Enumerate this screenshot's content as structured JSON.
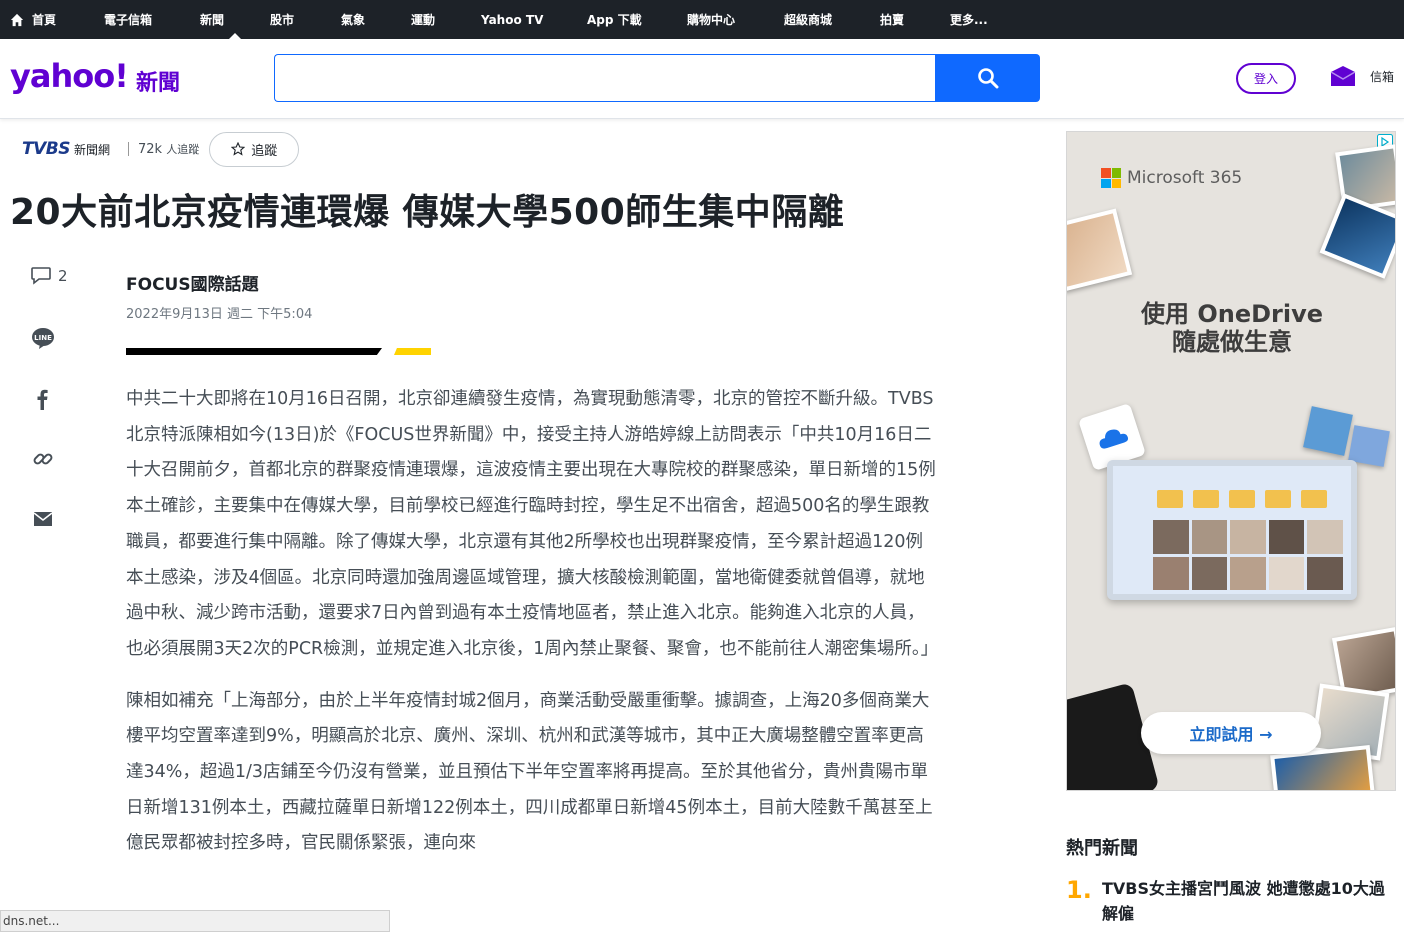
{
  "topnav": {
    "items": [
      "首頁",
      "電子信箱",
      "新聞",
      "股市",
      "氣象",
      "運動",
      "Yahoo TV",
      "App 下載",
      "購物中心",
      "超級商城",
      "拍賣",
      "更多..."
    ],
    "active_index": 2
  },
  "header": {
    "logo": "yahoo!",
    "logo_sub": "新聞",
    "search_value": "",
    "login_label": "登入",
    "mail_label": "信箱"
  },
  "source": {
    "publisher_logo": "TVBS",
    "publisher_sub": "新聞網",
    "followers_count": "72k",
    "followers_label": "人追蹤",
    "follow_label": "追蹤"
  },
  "article": {
    "headline": "20大前北京疫情連環爆 傳媒大學500師生集中隔離",
    "comment_count": "2",
    "author": "FOCUS國際話題",
    "date": "2022年9月13日 週二 下午5:04",
    "paragraphs": [
      "中共二十大即將在10月16日召開，北京卻連續發生疫情，為實現動態清零，北京的管控不斷升級。TVBS北京特派陳相如今(13日)於《FOCUS世界新聞》中，接受主持人游皓婷線上訪問表示「中共10月16日二十大召開前夕，首都北京的群聚疫情連環爆，這波疫情主要出現在大專院校的群聚感染，單日新增的15例本土確診，主要集中在傳媒大學，目前學校已經進行臨時封控，學生足不出宿舍，超過500名的學生跟教職員，都要進行集中隔離。除了傳媒大學，北京還有其他2所學校也出現群聚疫情，至今累計超過120例本土感染，涉及4個區。北京同時還加強周邊區域管理，擴大核酸檢測範圍，當地衛健委就曾倡導，就地過中秋、減少跨市活動，還要求7日內曾到過有本土疫情地區者，禁止進入北京。能夠進入北京的人員，也必須展開3天2次的PCR檢測，並規定進入北京後，1周內禁止聚餐、聚會，也不能前往人潮密集場所。」",
      "陳相如補充「上海部分，由於上半年疫情封城2個月，商業活動受嚴重衝擊。據調查，上海20多個商業大樓平均空置率達到9%，明顯高於北京、廣州、深圳、杭州和武漢等城市，其中正大廣場整體空置率更高達34%，超過1/3店鋪至今仍沒有營業，並且預估下半年空置率將再提高。至於其他省分，貴州貴陽市單日新增131例本土，西藏拉薩單日新增122例本土，四川成都單日新增45例本土，目前大陸數千萬甚至上億民眾都被封控多時，官民關係緊張，連向來"
    ]
  },
  "ad": {
    "brand": "Microsoft 365",
    "headline_line1": "使用 OneDrive",
    "headline_line2": "隨處做生意",
    "cta": "立即試用 →",
    "brand_colors": [
      "#f25022",
      "#7fba00",
      "#00a4ef",
      "#ffb900"
    ]
  },
  "trending": {
    "title": "熱門新聞",
    "items": [
      {
        "rank": "1.",
        "text": "TVBS女主播宮鬥風波 她遭懲處10大過解僱"
      }
    ]
  },
  "status_bar": {
    "text": "dns.net..."
  }
}
